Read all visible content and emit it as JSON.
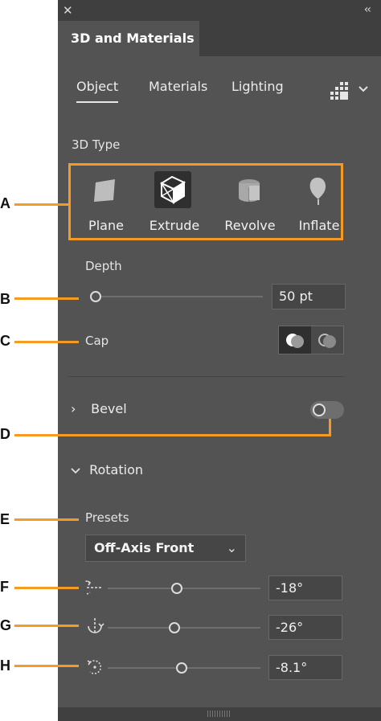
{
  "window": {
    "close_glyph": "✕",
    "collapse_glyph": "‹‹"
  },
  "panel": {
    "title": "3D and Materials"
  },
  "subtabs": [
    "Object",
    "Materials",
    "Lighting"
  ],
  "type_section": {
    "label": "3D Type",
    "items": [
      {
        "label": "Plane",
        "icon": "plane-icon",
        "selected": false
      },
      {
        "label": "Extrude",
        "icon": "extrude-icon",
        "selected": true
      },
      {
        "label": "Revolve",
        "icon": "revolve-icon",
        "selected": false
      },
      {
        "label": "Inflate",
        "icon": "inflate-icon",
        "selected": false
      }
    ]
  },
  "depth": {
    "label": "Depth",
    "value": "50 pt",
    "slider_fraction": 0.0
  },
  "cap": {
    "label": "Cap",
    "options": [
      "cap-on-icon",
      "cap-off-icon"
    ],
    "selected": 0
  },
  "bevel": {
    "label": "Bevel",
    "expanded": false,
    "enabled": false
  },
  "rotation": {
    "label": "Rotation",
    "expanded": true,
    "presets_label": "Presets",
    "preset_value": "Off-Axis Front",
    "axes": [
      {
        "icon": "rotate-x-icon",
        "value": "-18°"
      },
      {
        "icon": "rotate-y-icon",
        "value": "-26°"
      },
      {
        "icon": "rotate-z-icon",
        "value": "-8.1°"
      }
    ]
  },
  "callouts": [
    "A",
    "B",
    "C",
    "D",
    "E",
    "F",
    "G",
    "H"
  ],
  "colors": {
    "panel": "#535353",
    "header": "#3f3f3f",
    "callout": "#f59a23",
    "selected_tile": "#2f2f2f"
  }
}
